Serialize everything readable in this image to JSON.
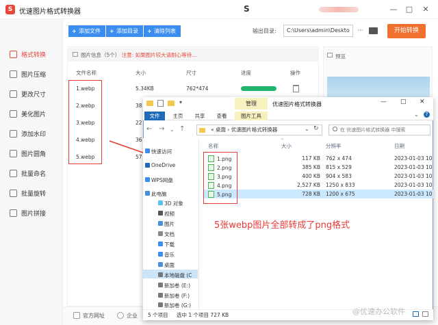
{
  "app": {
    "title": "优速图片格式转换器",
    "logo": "S"
  },
  "window_controls": [
    "—",
    "□",
    "✕"
  ],
  "sidebar": {
    "items": [
      {
        "label": "格式转换",
        "active": true
      },
      {
        "label": "图片压缩"
      },
      {
        "label": "更改尺寸"
      },
      {
        "label": "美化图片"
      },
      {
        "label": "添加水印"
      },
      {
        "label": "图片圆角"
      },
      {
        "label": "批量命名"
      },
      {
        "label": "批量旋转"
      },
      {
        "label": "图片拼接"
      }
    ]
  },
  "toolbar": {
    "add_file": "添加文件",
    "add_dir": "添加目录",
    "clear_list": "清除列表",
    "output_label": "输出目录:",
    "output_path": "C:\\Users\\admin\\Deskto",
    "start": "开始转换"
  },
  "file_panel": {
    "info_prefix": "图片信息（5个）",
    "info_warning": "注意: 如果图片较大请耐心等待...",
    "columns": [
      "文件名称",
      "大小",
      "尺寸",
      "进度",
      "操作"
    ],
    "rows": [
      {
        "name": "1.webp",
        "size": "5.34KB",
        "dims": "762*474",
        "progress": 1.0
      },
      {
        "name": "2.webp",
        "size": "38"
      },
      {
        "name": "3.webp",
        "size": "22"
      },
      {
        "name": "4.webp",
        "size": "36"
      },
      {
        "name": "5.webp",
        "size": "57"
      }
    ],
    "preview_label": "预览"
  },
  "footer": {
    "site": "官方网址",
    "enterprise": "企业"
  },
  "explorer": {
    "title": "优速图片格式转换器",
    "manage_tab": "管理",
    "tabs": [
      "文件",
      "主页",
      "共享",
      "查看",
      "图片工具"
    ],
    "address": [
      "桌面",
      "优速图片格式转换器"
    ],
    "search_placeholder": "在 优速图片格式转换器 中搜索",
    "nav": [
      "快速访问",
      "OneDrive",
      "WPS网盘",
      "此电脑",
      "3D 对象",
      "视频",
      "图片",
      "文档",
      "下载",
      "音乐",
      "桌面",
      "本地磁盘 (C",
      "新加卷 (E:)",
      "新加卷 (F:)",
      "新加卷 (G:)"
    ],
    "columns": [
      "名称",
      "大小",
      "分辨率",
      "日期"
    ],
    "files": [
      {
        "name": "1.png",
        "size": "117 KB",
        "res": "762 x 474",
        "date": "2023-01-03 10"
      },
      {
        "name": "2.png",
        "size": "385 KB",
        "res": "815 x 529",
        "date": "2023-01-03 10"
      },
      {
        "name": "3.png",
        "size": "400 KB",
        "res": "904 x 583",
        "date": "2023-01-03 10"
      },
      {
        "name": "4.png",
        "size": "2,527 KB",
        "res": "1250 x 833",
        "date": "2023-01-03 10"
      },
      {
        "name": "5.png",
        "size": "728 KB",
        "res": "1200 x 675",
        "date": "2023-01-03 10"
      }
    ],
    "status": [
      "5 个项目",
      "选中 1 个项目  727 KB"
    ]
  },
  "annotation": "5张webp图片全部转成了png格式",
  "watermark": "@优速办公软件",
  "colors": {
    "accent": "#e8473c",
    "blue": "#3b8ef0",
    "start": "#f07030",
    "progress": "#21b46e",
    "highlight": "#e53935"
  }
}
